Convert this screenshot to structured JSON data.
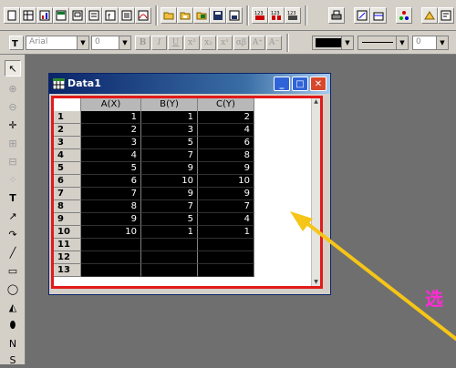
{
  "format_toolbar": {
    "font_name": "Arial",
    "font_size": "0",
    "color_fill": "#000000"
  },
  "window": {
    "title": "Data1",
    "minimize_glyph": "_",
    "restore_glyph": "□",
    "close_glyph": "✕"
  },
  "table": {
    "columns": [
      "A(X)",
      "B(Y)",
      "C(Y)"
    ],
    "row_labels": [
      "1",
      "2",
      "3",
      "4",
      "5",
      "6",
      "7",
      "8",
      "9",
      "10",
      "11",
      "12",
      "13"
    ],
    "rows": [
      [
        "1",
        "1",
        "2"
      ],
      [
        "2",
        "3",
        "4"
      ],
      [
        "3",
        "5",
        "6"
      ],
      [
        "4",
        "7",
        "8"
      ],
      [
        "5",
        "9",
        "9"
      ],
      [
        "6",
        "10",
        "10"
      ],
      [
        "7",
        "9",
        "9"
      ],
      [
        "8",
        "7",
        "7"
      ],
      [
        "9",
        "5",
        "4"
      ],
      [
        "10",
        "1",
        "1"
      ],
      [
        "",
        "",
        ""
      ],
      [
        "",
        "",
        ""
      ],
      [
        "",
        "",
        ""
      ]
    ]
  },
  "annotation": {
    "char": "选",
    "arrow_color": "#f5c518",
    "highlight_color": "#e21a1a"
  },
  "icons": {
    "new_worksheet": "worksheet-new-icon",
    "open": "folder-open-icon",
    "save": "save-icon",
    "print": "printer-icon",
    "pointer": "arrow-pointer-icon",
    "text_tool": "text-tool-icon"
  }
}
